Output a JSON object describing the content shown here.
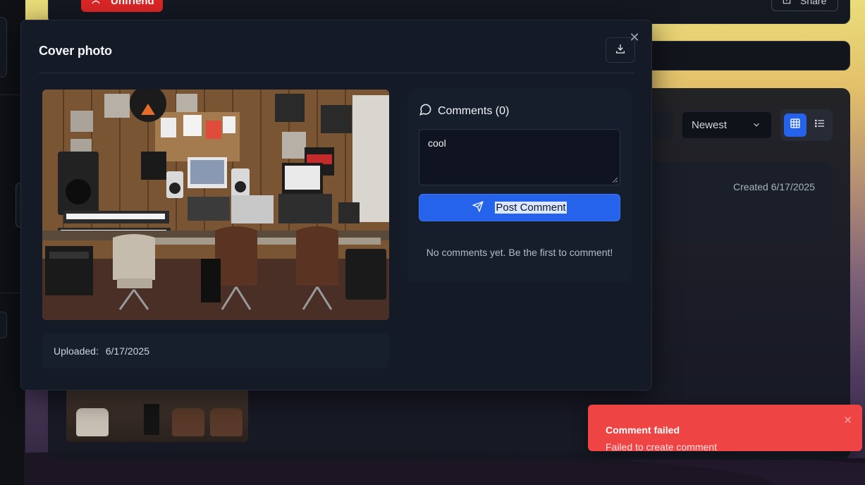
{
  "background": {
    "unfriend_label": "Unfriend",
    "share_label": "Share",
    "sort": {
      "selected": "Newest"
    },
    "view_mode": "grid",
    "album_card": {
      "created": "Created 6/17/2025"
    }
  },
  "modal": {
    "title": "Cover photo",
    "photo_description": "",
    "uploaded_label": "Uploaded:",
    "uploaded_date": "6/17/2025",
    "comments": {
      "header": "Comments (0)",
      "input_value": "cool",
      "post_label": "Post Comment",
      "empty_text": "No comments yet. Be the first to comment!"
    }
  },
  "toast": {
    "title": "Comment failed",
    "message": "Failed to create comment"
  },
  "colors": {
    "accent": "#2563eb",
    "danger": "#dc2626",
    "toast_bg": "#ef4444",
    "modal_bg": "#141a26"
  },
  "icons": [
    "user-icon",
    "share-icon",
    "chevron-down-icon",
    "grid-icon",
    "list-icon",
    "close-icon",
    "download-icon",
    "message-circle-icon",
    "send-icon"
  ]
}
